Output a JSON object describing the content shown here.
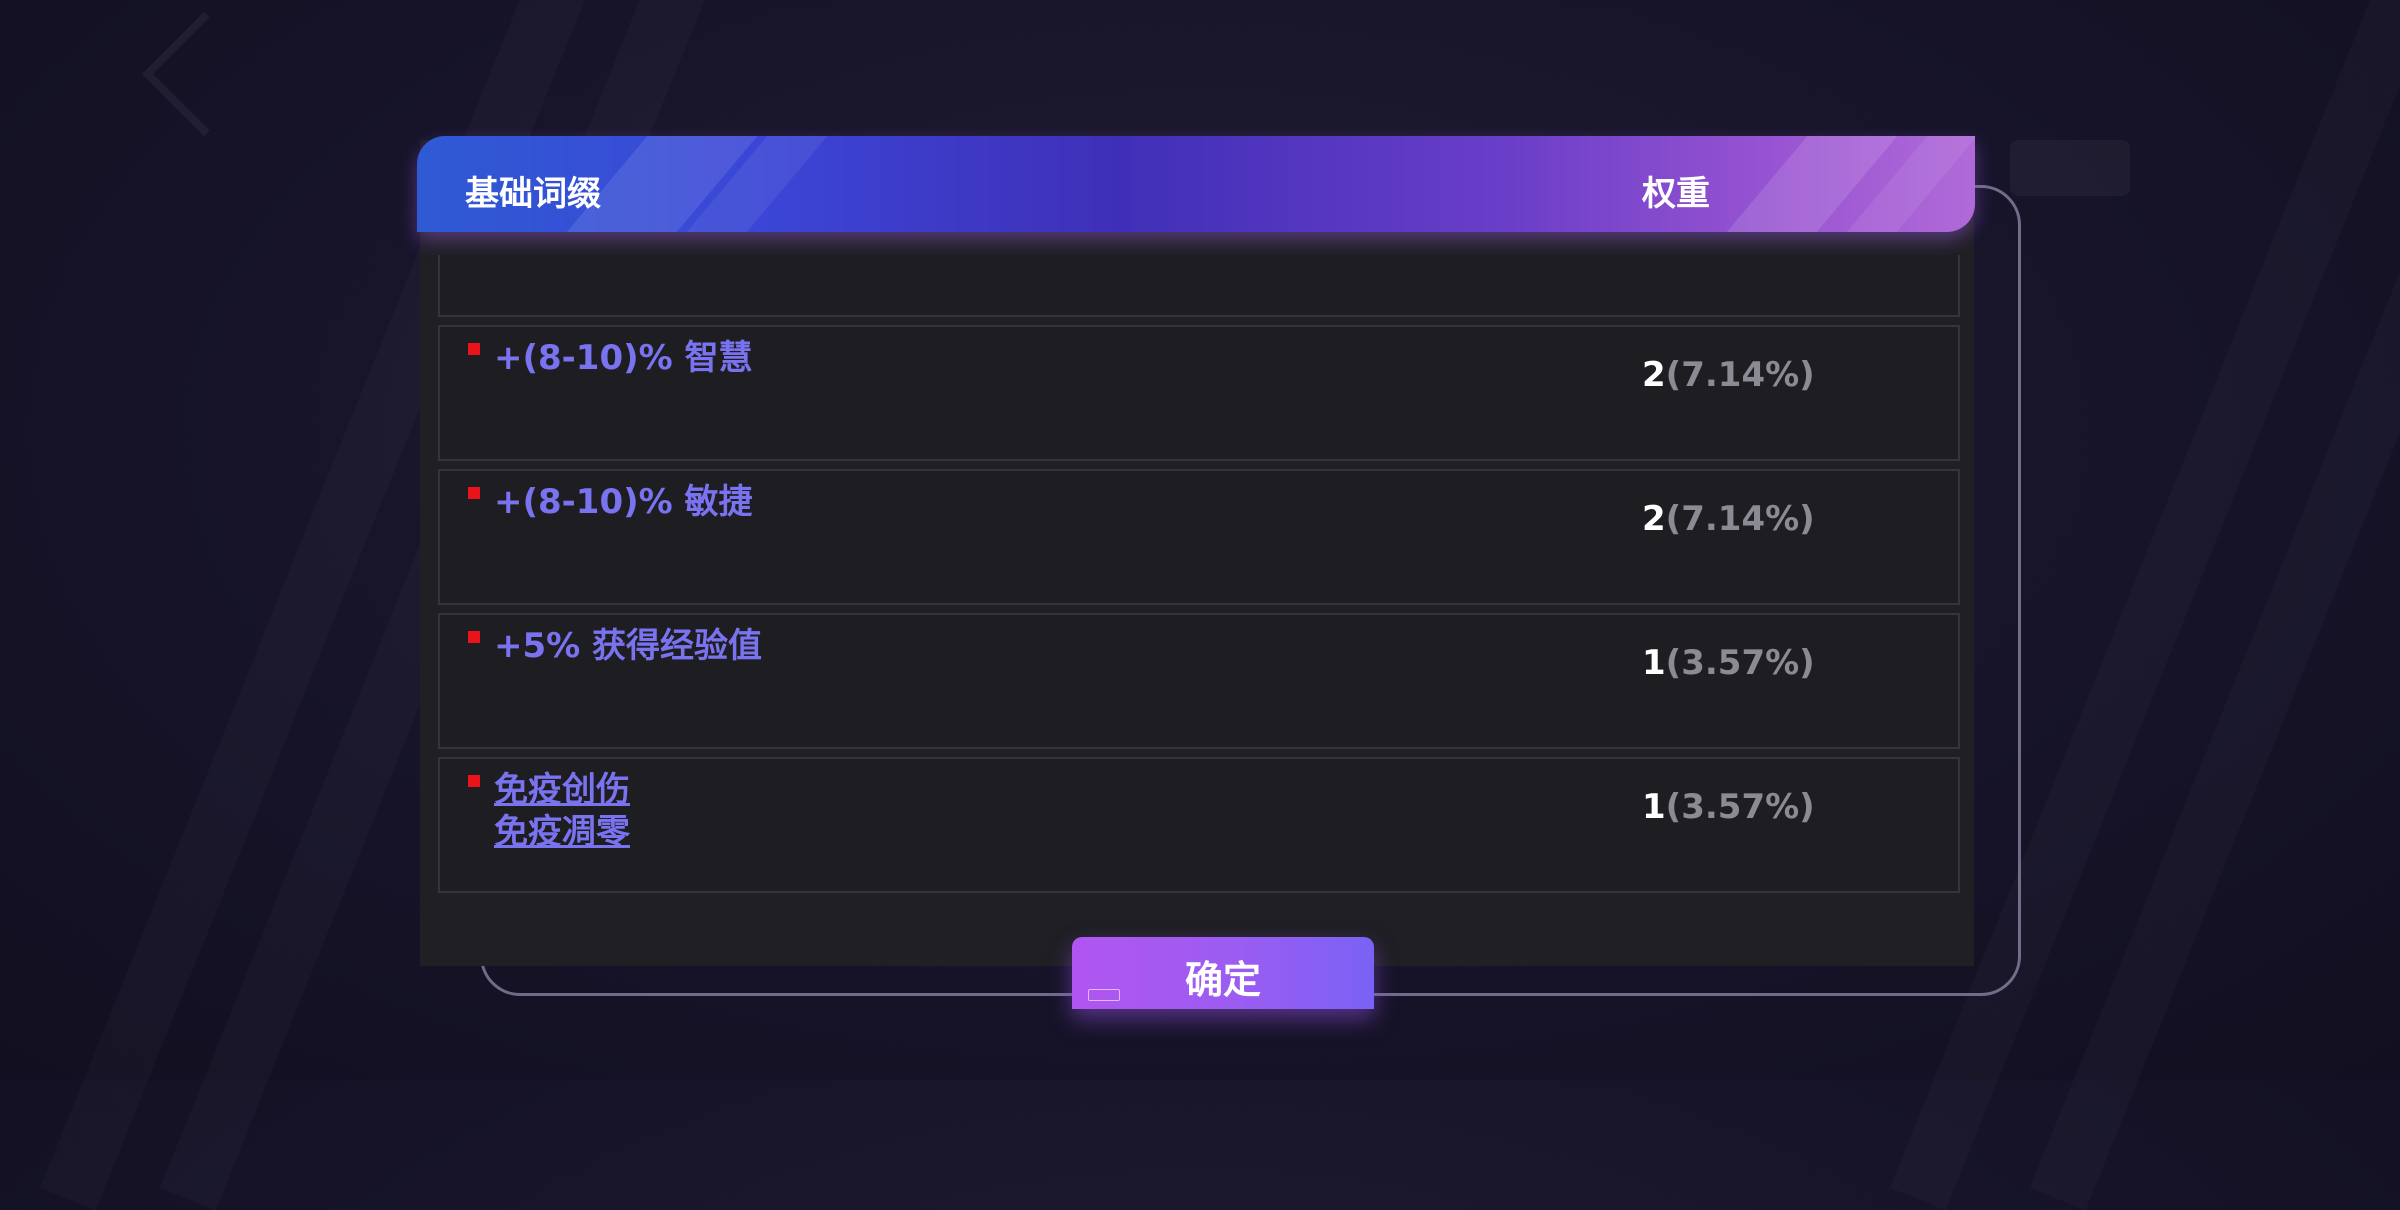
{
  "header": {
    "col_affix": "基础词缀",
    "col_weight": "权重"
  },
  "rows": [
    {
      "name_lines": [
        "+(8-10)% 智慧"
      ],
      "weight": "2",
      "percent": "(7.14%)",
      "underlined": false
    },
    {
      "name_lines": [
        "+(8-10)% 敏捷"
      ],
      "weight": "2",
      "percent": "(7.14%)",
      "underlined": false
    },
    {
      "name_lines": [
        "+5% 获得经验值"
      ],
      "weight": "1",
      "percent": "(3.57%)",
      "underlined": false
    },
    {
      "name_lines": [
        "免疫创伤",
        "免疫凋零"
      ],
      "weight": "1",
      "percent": "(3.57%)",
      "underlined": true
    }
  ],
  "confirm_button": {
    "label": "确定"
  },
  "colors": {
    "affix_text": "#7a73f0",
    "marker": "#e8141a",
    "percent_text": "#8b8b93",
    "button_start": "#b156f0",
    "button_end": "#7a62f5"
  },
  "icons": {
    "marker": "red-square-marker-icon"
  }
}
